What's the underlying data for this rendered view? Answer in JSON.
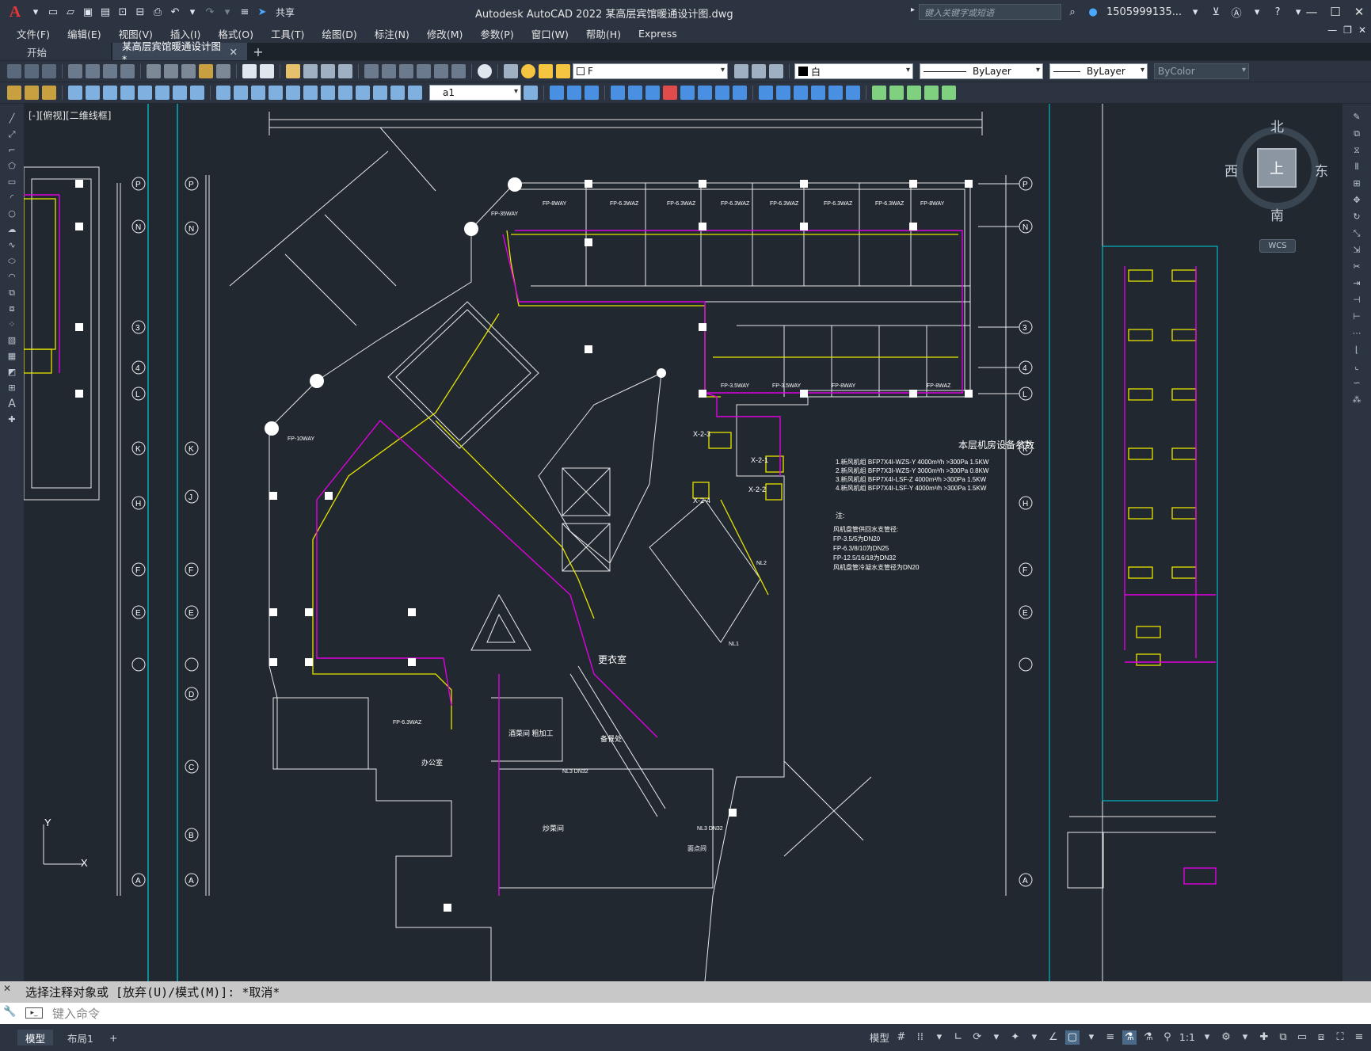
{
  "titlebar": {
    "app_logo": "A",
    "share_label": "共享",
    "title": "Autodesk AutoCAD 2022    某高层宾馆暖通设计图.dwg",
    "search_placeholder": "键入关键字或短语",
    "user": "1505999135...",
    "icons": [
      "new-icon",
      "open-icon",
      "save-icon",
      "save-as-icon",
      "open-web-icon",
      "save-web-icon",
      "plot-icon",
      "undo-icon",
      "redo-icon",
      "share-icon",
      "search-icon",
      "user-icon",
      "cart-icon",
      "autodesk-icon",
      "help-icon"
    ]
  },
  "menu": {
    "items": [
      "文件(F)",
      "编辑(E)",
      "视图(V)",
      "插入(I)",
      "格式(O)",
      "工具(T)",
      "绘图(D)",
      "标注(N)",
      "修改(M)",
      "参数(P)",
      "窗口(W)",
      "帮助(H)",
      "Express"
    ]
  },
  "tabs": [
    {
      "label": "开始",
      "active": false
    },
    {
      "label": "某高层宾馆暖通设计图*",
      "active": true
    }
  ],
  "toolbar1": {
    "layer_value": "F",
    "color_value": "白",
    "linetype_value": "ByLayer",
    "lineweight_value": "ByLayer",
    "plotstyle_value": "ByColor"
  },
  "toolbar2": {
    "dimstyle_value": "a1"
  },
  "viewport": {
    "view_label": "[-][俯视][二维线框]",
    "viewcube": {
      "north": "北",
      "south": "南",
      "west": "西",
      "east": "东",
      "face": "上"
    },
    "wcs_label": "WCS",
    "axis_y": "Y",
    "axis_x": "X"
  },
  "drawing": {
    "title": "本层机房设备参数",
    "params": [
      "1.新风机组 BFP7X4I-WZS-Y  4000m³/h  >300Pa  1.5KW",
      "2.新风机组 BFP7X3I-WZS-Y  3000m³/h  >300Pa  0.8KW",
      "3.新风机组 BFP7X4I-LSF-Z  4000m³/h  >300Pa  1.5KW",
      "4.新风机组 BFP7X4I-LSF-Y  4000m³/h  >300Pa  1.5KW"
    ],
    "notes_title": "注:",
    "notes": [
      "风机盘管供回水支管径:",
      "FP-3.5/5为DN20",
      "FP-6.3/8/10为DN25",
      "FP-12.5/16/18为DN32",
      "风机盘管冷凝水支管径为DN20"
    ],
    "room_labels": [
      "更衣室",
      "备餐处",
      "办公室",
      "炒菜间",
      "酒菜间 粗加工",
      "面点间"
    ],
    "ahu_labels": [
      "X-2-3",
      "X-2-1",
      "X-2-4",
      "X-2-2"
    ],
    "fcu_labels": [
      "FP-8WAY",
      "FP-6.3WAZ",
      "FP-6.3WAZ",
      "FP-6.3WAZ",
      "FP-6.3WAZ",
      "FP-6.3WAZ",
      "FP-6.3WAZ",
      "FP-8WAY",
      "FP-3.5WAY",
      "FP-3.5WAY",
      "FP-8WAY",
      "FP-8WAZ",
      "FP-10WAY",
      "FP-6.3WAZ",
      "FP-35WAY"
    ],
    "grid_right": [
      "P",
      "N",
      "3",
      "4",
      "L",
      "K",
      "H",
      "F",
      "E",
      "",
      "A"
    ],
    "grid_left": [
      "P",
      "N",
      "3",
      "4",
      "L",
      "K",
      "J",
      "H",
      "F",
      "E",
      "",
      "D",
      "C",
      "B",
      "A"
    ],
    "riser_labels": [
      "NL1",
      "NL2",
      "NL3 DN32",
      "NL3 DN32"
    ]
  },
  "command": {
    "history": "选择注释对象或 [放弃(U)/模式(M)]: *取消*",
    "placeholder": "键入命令"
  },
  "statusbar": {
    "layout_tabs": [
      "模型",
      "布局1"
    ],
    "model_label": "模型",
    "scale": "1:1"
  }
}
